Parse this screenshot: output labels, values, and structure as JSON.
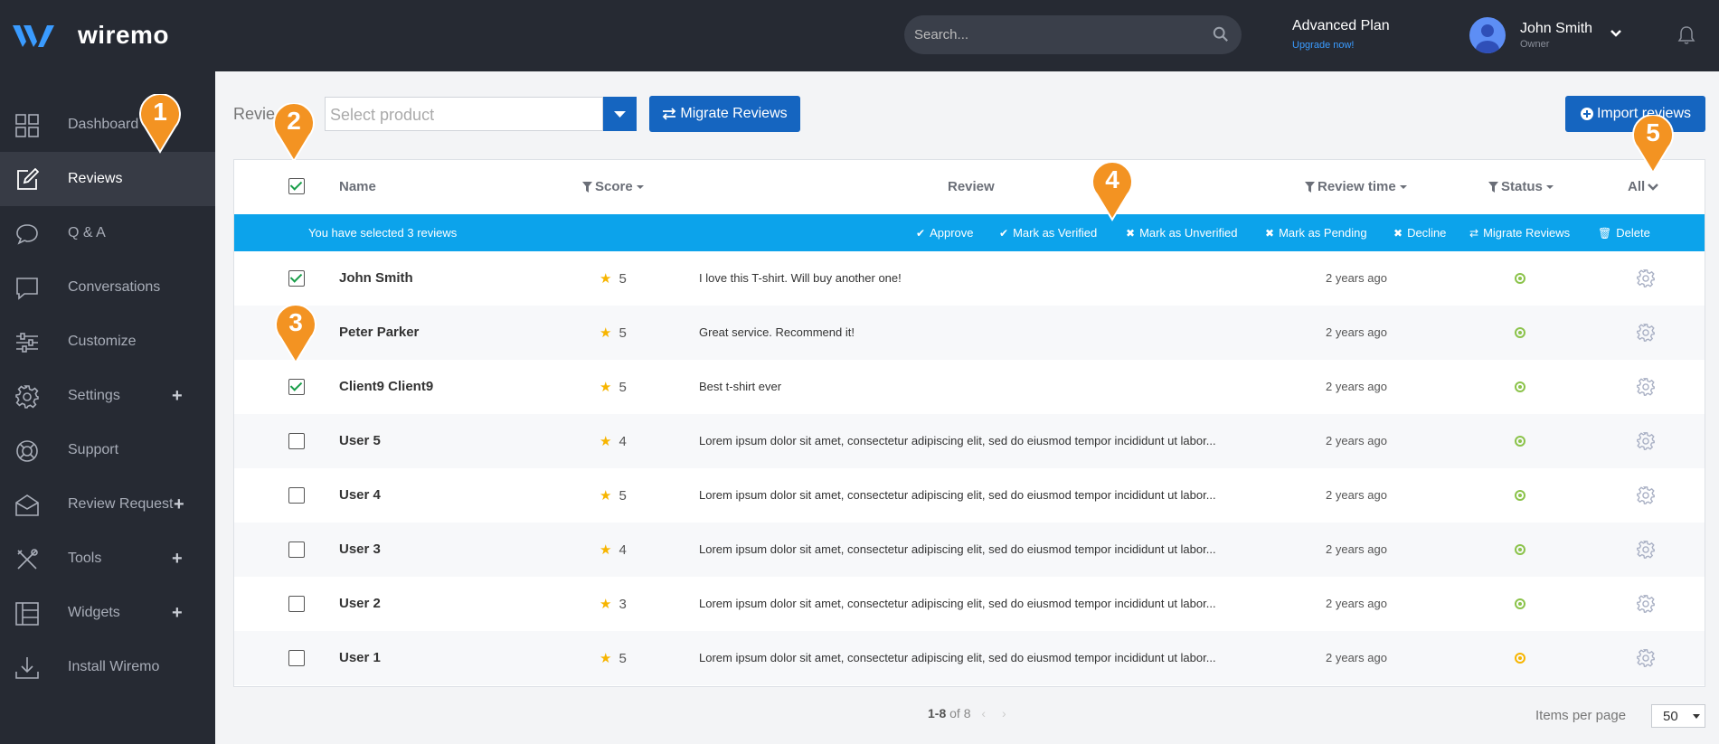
{
  "app": {
    "logo_text": "wiremo",
    "search_placeholder": "Search...",
    "plan_name": "Advanced Plan",
    "plan_link": "Upgrade now!",
    "user_name": "John Smith",
    "user_role": "Owner"
  },
  "sidebar": {
    "items": [
      {
        "label": "Dashboard",
        "icon": "grid-icon"
      },
      {
        "label": "Reviews",
        "icon": "edit-icon",
        "active": true
      },
      {
        "label": "Q & A",
        "icon": "chat-bubble-icon"
      },
      {
        "label": "Conversations",
        "icon": "message-square-icon"
      },
      {
        "label": "Customize",
        "icon": "sliders-icon"
      },
      {
        "label": "Settings",
        "icon": "gear-icon",
        "plus": true
      },
      {
        "label": "Support",
        "icon": "lifebuoy-icon"
      },
      {
        "label": "Review Request",
        "icon": "mail-open-icon",
        "plus": true
      },
      {
        "label": "Tools",
        "icon": "tools-icon",
        "plus": true
      },
      {
        "label": "Widgets",
        "icon": "layout-icon",
        "plus": true
      },
      {
        "label": "Install Wiremo",
        "icon": "download-icon"
      }
    ]
  },
  "main": {
    "title": "Revie",
    "product_placeholder": "Select product",
    "migrate_label": "Migrate Reviews",
    "import_label": "Import reviews"
  },
  "table": {
    "headers": {
      "name": "Name",
      "score": "Score",
      "review": "Review",
      "review_time": "Review time",
      "status": "Status",
      "all": "All"
    },
    "selection": {
      "text": "You have selected 3 reviews",
      "actions": [
        "Approve",
        "Mark as Verified",
        "Mark as Unverified",
        "Mark as Pending",
        "Decline",
        "Migrate Reviews",
        "Delete"
      ]
    },
    "rows": [
      {
        "name": "John Smith",
        "score": "5",
        "review": "I love this T-shirt. Will buy another one!",
        "time": "2 years ago",
        "checked": true,
        "status": "approved"
      },
      {
        "name": "Peter Parker",
        "score": "5",
        "review": "Great service. Recommend it!",
        "time": "2 years ago",
        "checked": false,
        "status": "approved"
      },
      {
        "name": "Client9 Client9",
        "score": "5",
        "review": "Best t-shirt ever",
        "time": "2 years ago",
        "checked": true,
        "status": "approved"
      },
      {
        "name": "User 5",
        "score": "4",
        "review": "Lorem ipsum dolor sit amet, consectetur adipiscing elit, sed do eiusmod tempor incididunt ut labor...",
        "time": "2 years ago",
        "checked": false,
        "status": "approved"
      },
      {
        "name": "User 4",
        "score": "5",
        "review": "Lorem ipsum dolor sit amet, consectetur adipiscing elit, sed do eiusmod tempor incididunt ut labor...",
        "time": "2 years ago",
        "checked": false,
        "status": "approved"
      },
      {
        "name": "User 3",
        "score": "4",
        "review": "Lorem ipsum dolor sit amet, consectetur adipiscing elit, sed do eiusmod tempor incididunt ut labor...",
        "time": "2 years ago",
        "checked": false,
        "status": "approved"
      },
      {
        "name": "User 2",
        "score": "3",
        "review": "Lorem ipsum dolor sit amet, consectetur adipiscing elit, sed do eiusmod tempor incididunt ut labor...",
        "time": "2 years ago",
        "checked": false,
        "status": "approved"
      },
      {
        "name": "User 1",
        "score": "5",
        "review": "Lorem ipsum dolor sit amet, consectetur adipiscing elit, sed do eiusmod tempor incididunt ut labor...",
        "time": "2 years ago",
        "checked": false,
        "status": "pending"
      }
    ]
  },
  "pagination": {
    "range": "1-8",
    "of_text": "of 8",
    "items_per_page_label": "Items per page",
    "items_per_page": "50"
  },
  "callouts": [
    "1",
    "2",
    "3",
    "4",
    "5"
  ],
  "colors": {
    "dark": "#262a33",
    "primary": "#1565c0",
    "selection_bar": "#0ca3eb",
    "callout": "#f39322",
    "star": "#f7b500",
    "status_ok": "#8bc34a"
  }
}
